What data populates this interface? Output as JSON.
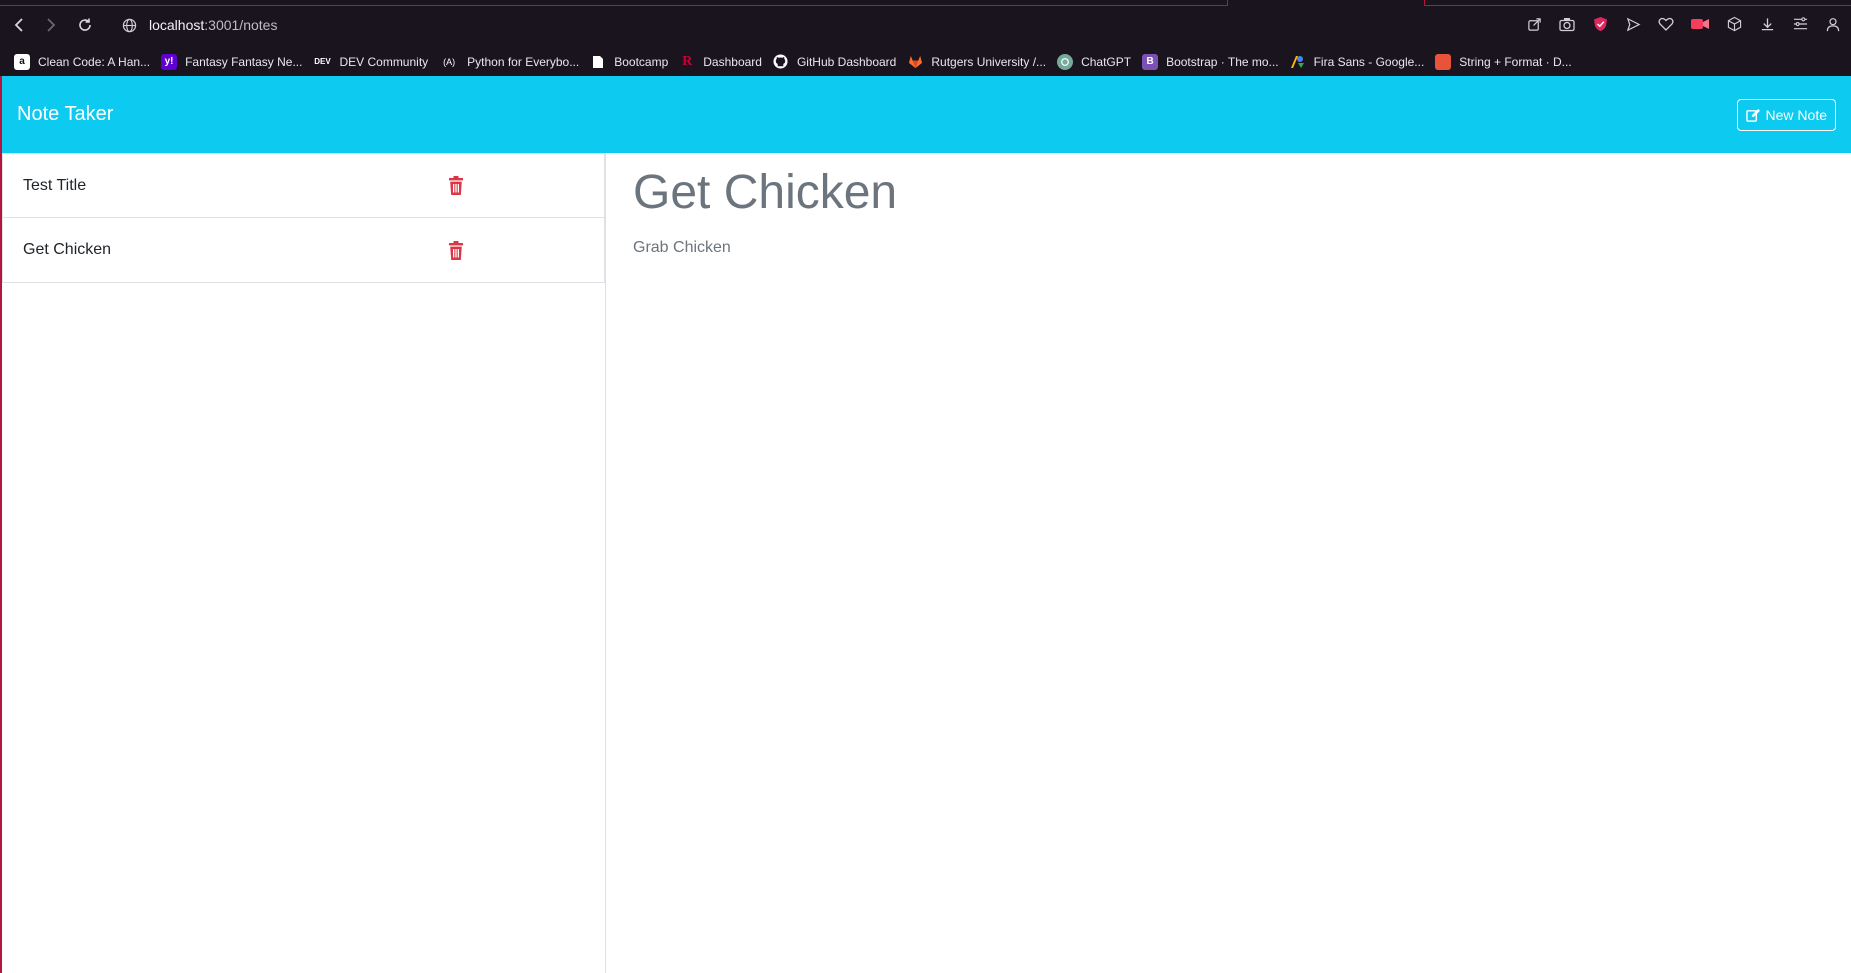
{
  "browser": {
    "url_host": "localhost",
    "url_path": ":3001/notes",
    "bookmarks": [
      {
        "label": "Clean Code: A Han...",
        "icon": "amazon-icon",
        "color": "#ffffff"
      },
      {
        "label": "Fantasy Fantasy Ne...",
        "icon": "yahoo-icon",
        "color": "#6001d2"
      },
      {
        "label": "DEV Community",
        "icon": "dev-icon",
        "color": "#1a141f"
      },
      {
        "label": "Python for Everybo...",
        "icon": "python-everybody-icon",
        "color": "#1a141f"
      },
      {
        "label": "Bootcamp",
        "icon": "page-icon",
        "color": "#1a141f"
      },
      {
        "label": "Dashboard",
        "icon": "rutgers-icon",
        "color": "#1a141f"
      },
      {
        "label": "GitHub Dashboard",
        "icon": "github-icon",
        "color": "#1a141f"
      },
      {
        "label": "Rutgers University /...",
        "icon": "gitlab-icon",
        "color": "#1a141f"
      },
      {
        "label": "ChatGPT",
        "icon": "chatgpt-icon",
        "color": "#74aa9c"
      },
      {
        "label": "Bootstrap · The mo...",
        "icon": "bootstrap-icon",
        "color": "#7952b3"
      },
      {
        "label": "Fira Sans - Google...",
        "icon": "google-fonts-icon",
        "color": "#1a141f"
      },
      {
        "label": "String + Format · D...",
        "icon": "docs-icon",
        "color": "#e8533a"
      }
    ]
  },
  "app": {
    "brand": "Note Taker",
    "new_note_label": "New Note",
    "notes": [
      {
        "title": "Test Title"
      },
      {
        "title": "Get Chicken"
      }
    ],
    "active_note": {
      "title": "Get Chicken",
      "text": "Grab Chicken"
    }
  },
  "colors": {
    "navbar": "#0dcaf0",
    "trash": "#dc3545",
    "accent": "#b3163f"
  }
}
